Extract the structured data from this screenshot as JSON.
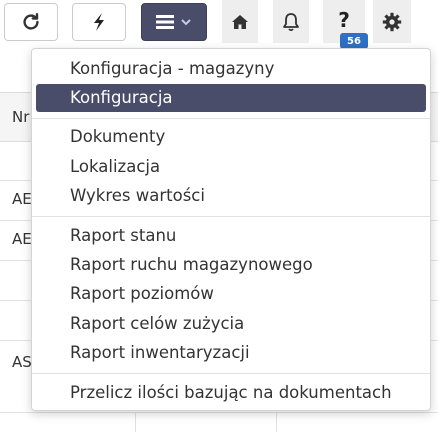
{
  "toolbar": {
    "refresh_icon": "refresh-icon",
    "flash_icon": "lightning-icon",
    "menu_icon": "hamburger-menu-icon",
    "home_icon": "home-icon",
    "bell_icon": "bell-icon",
    "help_label": "?",
    "help_badge": "56",
    "gear_icon": "gear-icon"
  },
  "background_table": {
    "header_fragment": "Nr",
    "row_fragments": [
      "AE",
      "AE",
      "AS"
    ]
  },
  "menu": {
    "groups": [
      [
        "Konfiguracja - magazyny",
        "Konfiguracja"
      ],
      [
        "Dokumenty",
        "Lokalizacja",
        "Wykres wartości"
      ],
      [
        "Raport stanu",
        "Raport ruchu magazynowego",
        "Raport poziomów",
        "Raport celów zużycia",
        "Raport inwentaryzacji"
      ],
      [
        "Przelicz ilości bazując na dokumentach"
      ]
    ],
    "active_item": "Konfiguracja"
  },
  "colors": {
    "accent": "#4a4d6a",
    "badge": "#2f6fc4",
    "icon_bg": "#eeeeee"
  }
}
